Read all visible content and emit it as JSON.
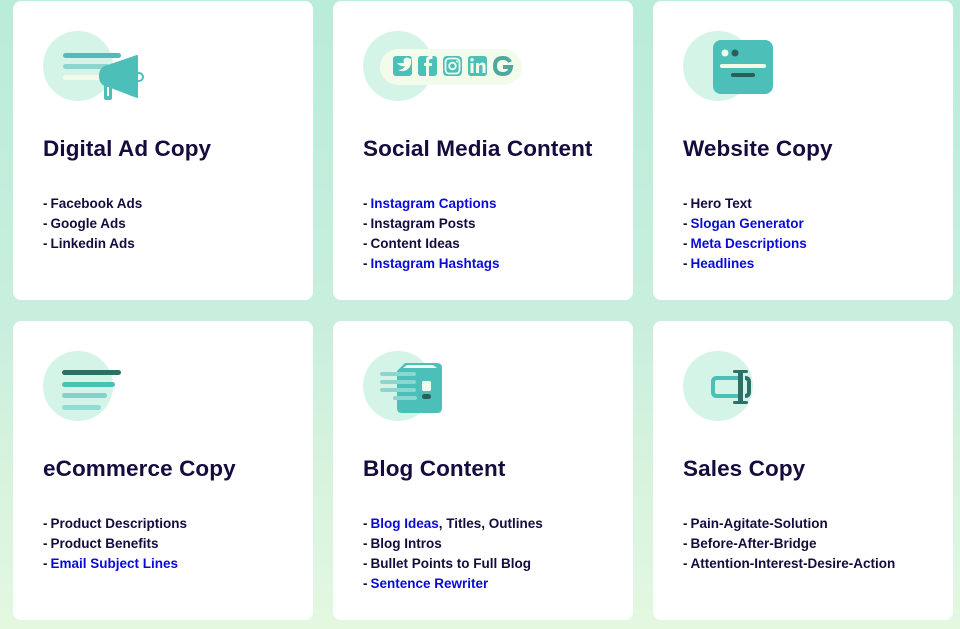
{
  "colors": {
    "title": "#160b3d",
    "text": "#160b3d",
    "link": "#0a0ad8",
    "icon_teal": "#4bbfb8",
    "icon_dark": "#2c7068",
    "icon_circle": "#d3f4e6",
    "card_bg": "#ffffff"
  },
  "cards": [
    {
      "title": "Digital Ad Copy",
      "icon": "megaphone-icon",
      "items": [
        {
          "parts": [
            {
              "text": "Facebook Ads",
              "link": false
            }
          ]
        },
        {
          "parts": [
            {
              "text": "Google Ads",
              "link": false
            }
          ]
        },
        {
          "parts": [
            {
              "text": "Linkedin Ads",
              "link": false
            }
          ]
        }
      ]
    },
    {
      "title": "Social Media Content",
      "icon": "social-media-icons",
      "social_icons": [
        "twitter-icon",
        "facebook-icon",
        "instagram-icon",
        "linkedin-icon",
        "google-icon"
      ],
      "items": [
        {
          "parts": [
            {
              "text": "Instagram Captions",
              "link": true
            }
          ]
        },
        {
          "parts": [
            {
              "text": "Instagram Posts",
              "link": false
            }
          ]
        },
        {
          "parts": [
            {
              "text": "Content Ideas",
              "link": false
            }
          ]
        },
        {
          "parts": [
            {
              "text": "Instagram Hashtags",
              "link": true
            }
          ]
        }
      ]
    },
    {
      "title": "Website Copy",
      "icon": "webpage-icon",
      "items": [
        {
          "parts": [
            {
              "text": "Hero Text",
              "link": false
            }
          ]
        },
        {
          "parts": [
            {
              "text": "Slogan Generator",
              "link": true
            }
          ]
        },
        {
          "parts": [
            {
              "text": "Meta Descriptions",
              "link": true
            }
          ]
        },
        {
          "parts": [
            {
              "text": "Headlines",
              "link": true
            }
          ]
        }
      ]
    },
    {
      "title": "eCommerce Copy",
      "icon": "text-lines-icon",
      "items": [
        {
          "parts": [
            {
              "text": "Product Descriptions",
              "link": false
            }
          ]
        },
        {
          "parts": [
            {
              "text": "Product Benefits",
              "link": false
            }
          ]
        },
        {
          "parts": [
            {
              "text": "Email Subject Lines",
              "link": true
            }
          ]
        }
      ]
    },
    {
      "title": "Blog Content",
      "icon": "blog-post-icon",
      "items": [
        {
          "parts": [
            {
              "text": "Blog Ideas",
              "link": true
            },
            {
              "text": ", Titles, Outlines",
              "link": false
            }
          ]
        },
        {
          "parts": [
            {
              "text": "Blog Intros",
              "link": false
            }
          ]
        },
        {
          "parts": [
            {
              "text": "Bullet Points to Full Blog",
              "link": false
            }
          ]
        },
        {
          "parts": [
            {
              "text": "Sentence Rewriter",
              "link": true
            }
          ]
        }
      ]
    },
    {
      "title": "Sales Copy",
      "icon": "text-cursor-icon",
      "items": [
        {
          "parts": [
            {
              "text": "Pain-Agitate-Solution",
              "link": false
            }
          ]
        },
        {
          "parts": [
            {
              "text": "Before-After-Bridge",
              "link": false
            }
          ]
        },
        {
          "parts": [
            {
              "text": "Attention-Interest-Desire-Action",
              "link": false
            }
          ]
        }
      ]
    }
  ],
  "list_dash": "-"
}
